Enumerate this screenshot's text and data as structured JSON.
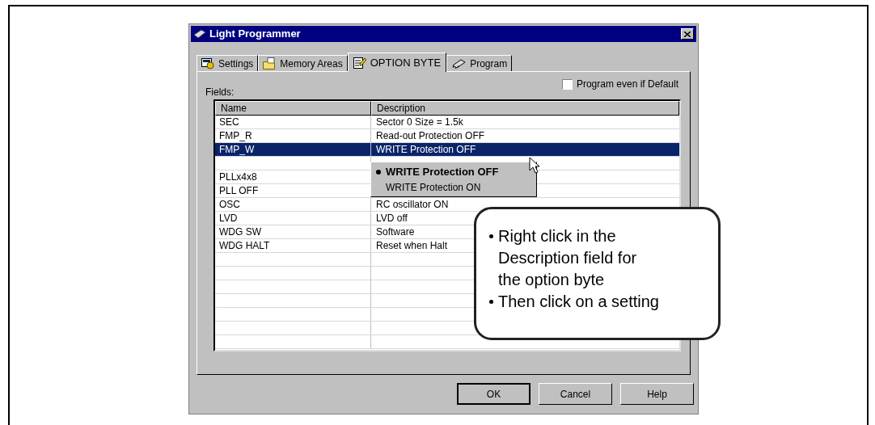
{
  "window": {
    "title": "Light Programmer"
  },
  "tabs": [
    {
      "label": "Settings",
      "selected": false,
      "kind": "settings"
    },
    {
      "label": "Memory Areas",
      "selected": false,
      "kind": "memory"
    },
    {
      "label": "OPTION BYTE",
      "selected": true,
      "kind": "option"
    },
    {
      "label": "Program",
      "selected": false,
      "kind": "chip"
    }
  ],
  "fields_label": "Fields:",
  "program_even_if_default": {
    "label": "Program even if Default",
    "checked": false
  },
  "table": {
    "columns": [
      "Name",
      "Description"
    ],
    "rows": [
      {
        "name": "SEC",
        "description": "Sector 0 Size = 1.5k",
        "selected": false
      },
      {
        "name": "FMP_R",
        "description": "Read-out Protection OFF",
        "selected": false
      },
      {
        "name": "FMP_W",
        "description": "WRITE Protection OFF",
        "selected": true
      },
      {
        "selected": false
      },
      {
        "name": "PLLx4x8",
        "selected": false
      },
      {
        "name": "PLL OFF",
        "selected": false
      },
      {
        "name": "OSC",
        "description": "RC oscillator ON",
        "selected": false
      },
      {
        "name": "LVD",
        "description": "LVD off",
        "selected": false
      },
      {
        "name": "WDG SW",
        "description": "Software",
        "selected": false
      },
      {
        "name": "WDG HALT",
        "description": "Reset when Halt",
        "selected": false
      },
      {
        "selected": false
      },
      {
        "selected": false
      },
      {
        "selected": false
      },
      {
        "selected": false
      },
      {
        "selected": false
      },
      {
        "selected": false
      },
      {
        "selected": false
      }
    ]
  },
  "context_menu": [
    {
      "label": "WRITE Protection OFF",
      "selected": true
    },
    {
      "label": "WRITE Protection ON",
      "selected": false
    }
  ],
  "buttons": [
    {
      "label": "OK",
      "default": true
    },
    {
      "label": "Cancel",
      "default": false
    },
    {
      "label": "Help",
      "default": false
    }
  ],
  "callout": [
    "Right click in the Description field for the option byte",
    "Then click on a setting"
  ]
}
